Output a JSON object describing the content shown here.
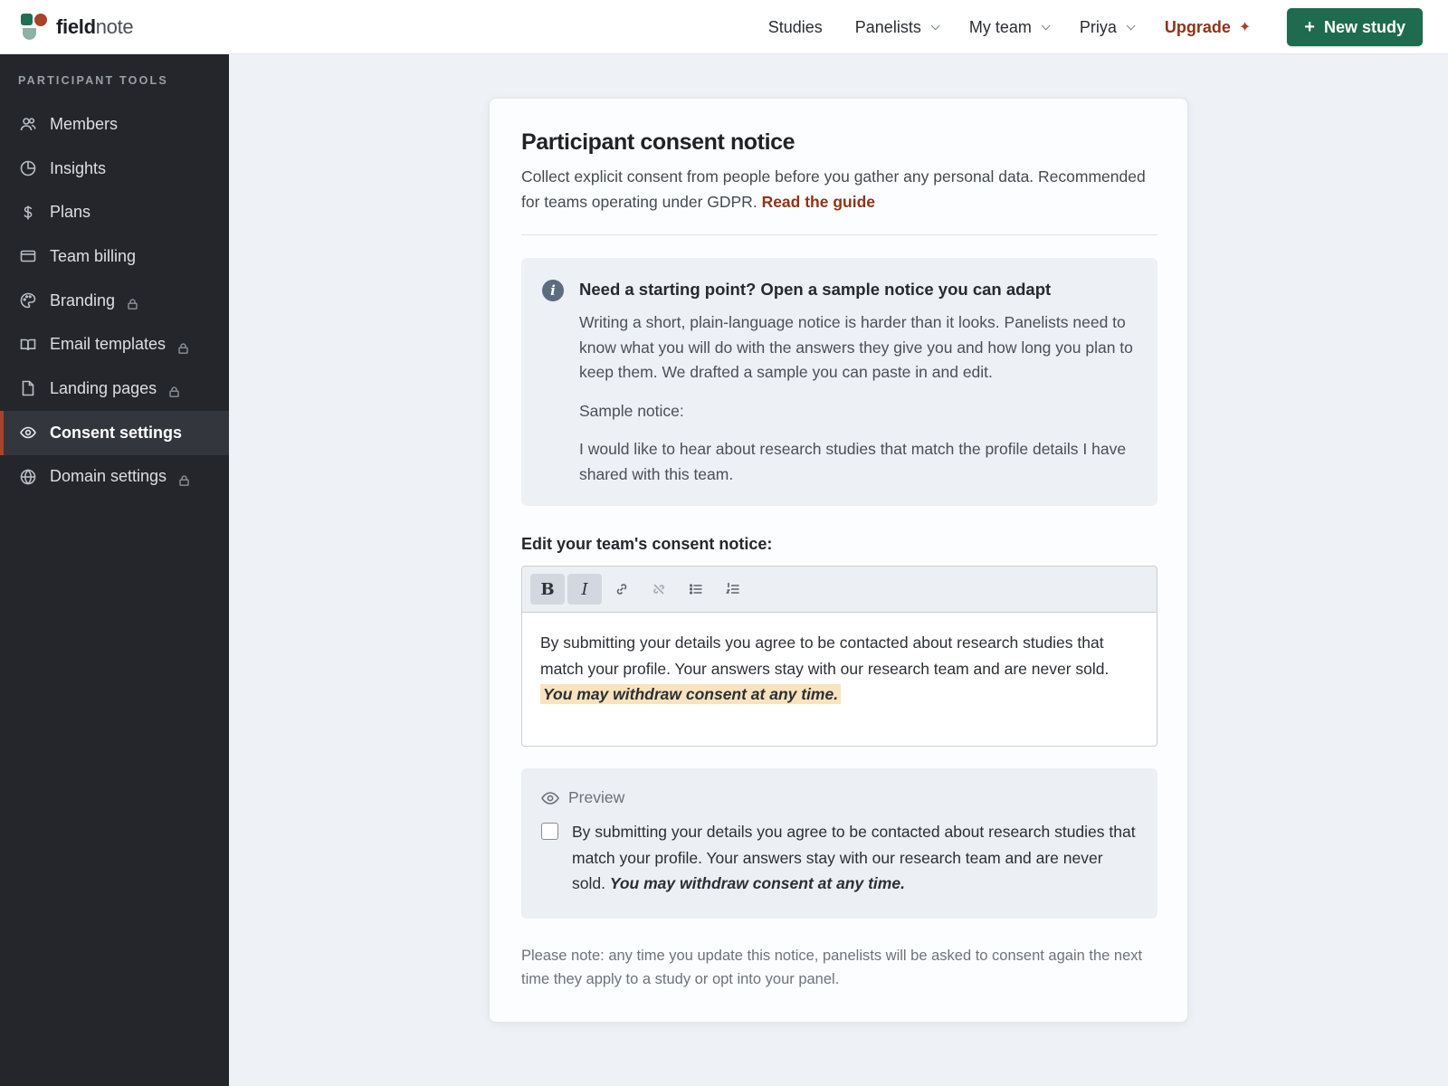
{
  "app": {
    "brand_bold": "field",
    "brand_light": "note"
  },
  "nav": {
    "studies": "Studies",
    "panelists": "Panelists",
    "my_team": "My team",
    "user": "Priya",
    "upgrade": "Upgrade",
    "upgrade_icon": "sparkle-icon",
    "new_study": "New study"
  },
  "sidebar": {
    "heading": "PARTICIPANT TOOLS",
    "items": [
      {
        "label": "Members",
        "icon": "users-icon",
        "locked": false,
        "active": false
      },
      {
        "label": "Insights",
        "icon": "pie-chart-icon",
        "locked": false,
        "active": false
      },
      {
        "label": "Plans",
        "icon": "dollar-icon",
        "locked": false,
        "active": false
      },
      {
        "label": "Team billing",
        "icon": "credit-card-icon",
        "locked": false,
        "active": false
      },
      {
        "label": "Branding",
        "icon": "palette-icon",
        "locked": true,
        "active": false
      },
      {
        "label": "Email templates",
        "icon": "book-icon",
        "locked": true,
        "active": false
      },
      {
        "label": "Landing pages",
        "icon": "file-icon",
        "locked": true,
        "active": false
      },
      {
        "label": "Consent settings",
        "icon": "eye-icon",
        "locked": false,
        "active": true
      },
      {
        "label": "Domain settings",
        "icon": "globe-icon",
        "locked": true,
        "active": false
      }
    ]
  },
  "card": {
    "title": "Participant consent notice",
    "subtitle": "Collect explicit consent from people before you gather any personal data. Recommended for teams operating under GDPR.",
    "guide_link": "Read the guide",
    "info": {
      "icon": "info-icon",
      "heading": "Need a starting point? Open a sample notice you can adapt",
      "body": "Writing a short, plain-language notice is harder than it looks. Panelists need to know what you will do with the answers they give you and how long you plan to keep them. We drafted a sample you can paste in and edit.",
      "sample_label": "Sample notice:",
      "sample_text": "I would like to hear about research studies that match the profile details I have shared with this team."
    },
    "edit_label": "Edit your team's consent notice:",
    "editor": {
      "toolbar": [
        "bold-button",
        "italic-button",
        "link-icon",
        "unlink-icon",
        "bullet-list-icon",
        "numbered-list-icon"
      ],
      "bold_glyph": "B",
      "italic_glyph": "I",
      "text": "By submitting your details you agree to be contacted about research studies that match your profile. Your answers stay with our research team and are never sold.",
      "highlight": "You may withdraw consent at any time."
    },
    "preview": {
      "label": "Preview",
      "text": "By submitting your details you agree to be contacted about research studies that match your profile. Your answers stay with our research team and are never sold.",
      "emphasis": "You may withdraw consent at any time.",
      "checked": false
    },
    "note": "Please note: any time you update this notice, panelists will be asked to consent again the next time they apply to a study or opt into your panel."
  },
  "colors": {
    "accent_green": "#1e6b50",
    "accent_rust": "#8e3419",
    "sidebar_bg": "#24262b",
    "highlight": "#f9e3bf"
  }
}
